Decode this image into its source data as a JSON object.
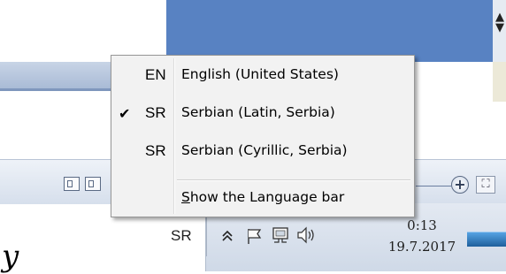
{
  "background": {
    "left_letter": "y"
  },
  "language_menu": {
    "items": [
      {
        "code": "EN",
        "label": "English (United States)",
        "checked": false
      },
      {
        "code": "SR",
        "label": "Serbian (Latin, Serbia)",
        "checked": true
      },
      {
        "code": "SR",
        "label": "Serbian (Cyrillic, Serbia)",
        "checked": false
      }
    ],
    "check_glyph": "✔",
    "show_bar_label_prefix": "S",
    "show_bar_label_rest": "how the Language bar"
  },
  "taskbar": {
    "language_indicator": "SR",
    "tray_icons": [
      "chevron-up-icon",
      "flag-icon",
      "network-icon",
      "speaker-icon"
    ],
    "clock_time": "0:13",
    "clock_date": "19.7.2017"
  },
  "toolbar": {
    "zoom_in_glyph": "+",
    "fit_glyph": "⛶"
  },
  "colors": {
    "title_blue": "#5882c2",
    "menu_bg": "#f2f2f2",
    "taskbar_bg": "#d9e1ed"
  }
}
